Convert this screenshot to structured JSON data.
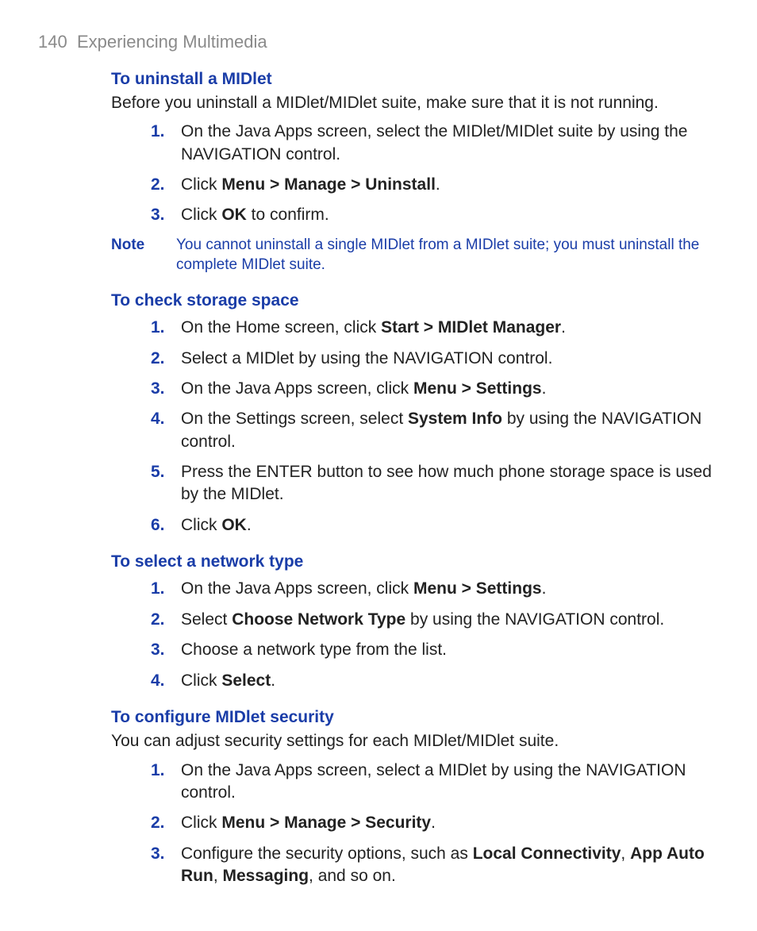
{
  "header": {
    "page_num": "140",
    "chapter": "Experiencing Multimedia"
  },
  "sections": {
    "uninstall": {
      "heading": "To uninstall a MIDlet",
      "intro": "Before you uninstall a MIDlet/MIDlet suite, make sure that it is not running.",
      "steps": {
        "s1": {
          "num": "1.",
          "text": "On the Java Apps screen, select the MIDlet/MIDlet suite by using the NAVIGATION control."
        },
        "s2": {
          "num": "2.",
          "a": "Click ",
          "b": "Menu > Manage > Uninstall",
          "c": "."
        },
        "s3": {
          "num": "3.",
          "a": "Click ",
          "b": "OK",
          "c": " to confirm."
        }
      }
    },
    "note": {
      "label": "Note",
      "body": "You cannot uninstall a single MIDlet from a MIDlet suite; you must uninstall the complete MIDlet suite."
    },
    "storage": {
      "heading": "To check storage space",
      "steps": {
        "s1": {
          "num": "1.",
          "a": "On the Home screen, click ",
          "b": "Start > MIDlet Manager",
          "c": "."
        },
        "s2": {
          "num": "2.",
          "text": "Select a MIDlet by using the NAVIGATION control."
        },
        "s3": {
          "num": "3.",
          "a": "On the Java Apps screen, click ",
          "b": "Menu > Settings",
          "c": "."
        },
        "s4": {
          "num": "4.",
          "a": "On the Settings screen, select ",
          "b": "System Info",
          "c": " by using the NAVIGATION control."
        },
        "s5": {
          "num": "5.",
          "text": "Press the ENTER button to see how much phone storage space is used by the MIDlet."
        },
        "s6": {
          "num": "6.",
          "a": "Click ",
          "b": "OK",
          "c": "."
        }
      }
    },
    "network": {
      "heading": "To select a network type",
      "steps": {
        "s1": {
          "num": "1.",
          "a": "On the Java Apps screen, click ",
          "b": "Menu > Settings",
          "c": "."
        },
        "s2": {
          "num": "2.",
          "a": "Select ",
          "b": "Choose Network Type",
          "c": " by using the NAVIGATION control."
        },
        "s3": {
          "num": "3.",
          "text": "Choose a network type from the list."
        },
        "s4": {
          "num": "4.",
          "a": "Click ",
          "b": "Select",
          "c": "."
        }
      }
    },
    "security": {
      "heading": "To configure MIDlet security",
      "intro": "You can adjust security settings for each MIDlet/MIDlet suite.",
      "steps": {
        "s1": {
          "num": "1.",
          "text": "On the Java Apps screen, select a MIDlet by using the NAVIGATION control."
        },
        "s2": {
          "num": "2.",
          "a": "Click ",
          "b": "Menu > Manage > Security",
          "c": "."
        },
        "s3": {
          "num": "3.",
          "a": "Configure the security options, such as ",
          "b": "Local Connectivity",
          "c": ", ",
          "d": "App Auto Run",
          "e": ", ",
          "f": "Messaging",
          "g": ", and so on."
        }
      }
    }
  }
}
